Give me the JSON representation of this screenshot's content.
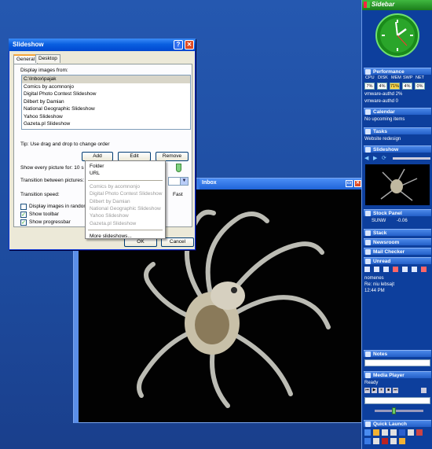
{
  "dialog": {
    "title": "Slideshow",
    "tabs": [
      "General",
      "Desktop"
    ],
    "display_images_from": "Display images from:",
    "sources": [
      "C:\\Inbox\\pajak",
      "Comics by acomnonjo",
      "Digital Photo Contest Slideshow",
      "Dilbert by Damian",
      "National Geographic Slideshow",
      "Yahoo Slideshow",
      "Gazeta.pl Slideshow"
    ],
    "tip": "Tip: Use drag and drop to change order",
    "add_label": "Add",
    "edit_label": "Edit",
    "remove_label": "Remove",
    "show_every": "Show every picture for: 10 s",
    "transition_between": "Transition between pictures:",
    "transition_speed": "Transition speed:",
    "fast_label": "Fast",
    "opt_random": "Display images in random",
    "opt_toolbar": "Show toolbar",
    "opt_progressbar": "Show progressbar",
    "ok_label": "OK",
    "cancel_label": "Cancel"
  },
  "menu": {
    "items": [
      "Folder",
      "URL"
    ],
    "disabled": [
      "Comics by acomnonjo",
      "Digital Photo Contest Slideshow",
      "Dilbert by Damian",
      "National Geographic Slideshow",
      "Yahoo Slideshow",
      "Gazeta.pl Slideshow"
    ],
    "more": "More slideshows..."
  },
  "image_window": {
    "title": "Inbox"
  },
  "sidebar": {
    "title": "Sidebar",
    "performance": "Performance",
    "perf_labels": [
      "CPU",
      "DISK",
      "MEM",
      "SWP",
      "NET"
    ],
    "perf_values": [
      "7%",
      "4%",
      "71%",
      "4%",
      "0%"
    ],
    "proc1": "vmware-authd 2%",
    "proc2": "vmware-authd 0",
    "calendar": "Calendar",
    "calendar_text": "No upcoming items",
    "tasks": "Tasks",
    "tasks_text": "Website redesign",
    "slideshow": "Slideshow",
    "stock_panel": "Stock Panel",
    "stock_sym": "SUNW",
    "stock_val": "-0.06",
    "stack": "Stack",
    "newsroom": "Newsroom",
    "mail_checker": "Mail Checker",
    "unread": "Unread",
    "mail_from": "nomenes",
    "mail_subject": "Re: niu lebsajt",
    "mail_time": "12:44 PM",
    "notes": "Notes",
    "media_player": "Media Player",
    "media_status": "Ready",
    "quick_launch": "Quick Launch"
  }
}
